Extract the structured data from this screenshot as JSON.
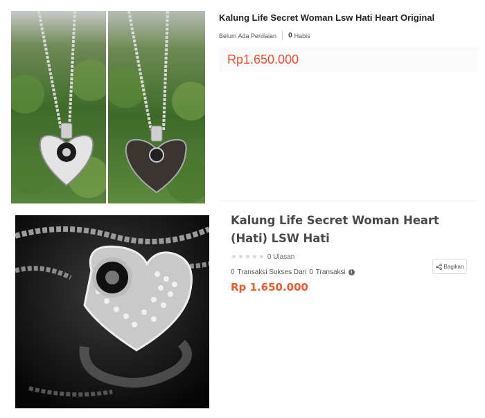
{
  "top_listing": {
    "title": "Kalung Life Secret Woman Lsw Hati Heart Original",
    "rating_text": "Belum Ada Penilaian",
    "sold_count": "0",
    "sold_label": "Habis",
    "price": "Rp1.650.000",
    "images": [
      "necklace-front-photo",
      "necklace-back-photo"
    ]
  },
  "bottom_listing": {
    "title": "Kalung Life Secret Woman Heart (Hati) LSW Hati",
    "rating_stars": 0,
    "review_count": "0",
    "review_label": "Ulasan",
    "success_count": "0",
    "success_label": "Transaksi Sukses Dari",
    "transaction_count": "0",
    "transaction_label": "Transaksi",
    "price": "Rp 1.650.000",
    "share_label": "Bagikan",
    "image": "necklace-closeup-photo"
  },
  "colors": {
    "price_top": "#ee4d2d",
    "price_bottom": "#ef5a2a",
    "star_empty": "#d6d6d6"
  },
  "icons": [
    "info-icon",
    "share-icon",
    "star-icon"
  ]
}
